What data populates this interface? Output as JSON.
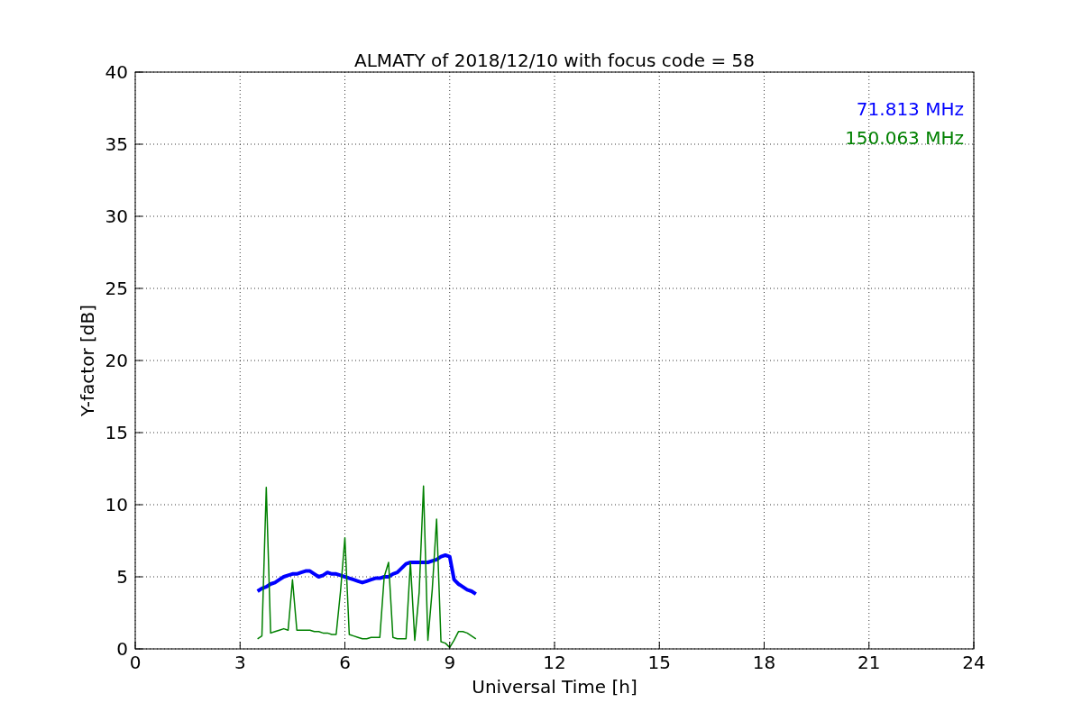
{
  "figure": {
    "chart_data": {
      "type": "line",
      "title": "ALMATY of 2018/12/10 with focus code = 58",
      "xlabel": "Universal Time [h]",
      "ylabel": "Y-factor [dB]",
      "x": [
        3.5,
        3.625,
        3.75,
        3.875,
        4.0,
        4.125,
        4.25,
        4.375,
        4.5,
        4.625,
        4.75,
        4.875,
        5.0,
        5.125,
        5.25,
        5.375,
        5.5,
        5.625,
        5.75,
        5.875,
        6.0,
        6.125,
        6.25,
        6.375,
        6.5,
        6.625,
        6.75,
        6.875,
        7.0,
        7.125,
        7.25,
        7.375,
        7.5,
        7.625,
        7.75,
        7.875,
        8.0,
        8.125,
        8.25,
        8.375,
        8.5,
        8.625,
        8.75,
        8.875,
        9.0,
        9.125,
        9.25,
        9.375,
        9.5,
        9.625,
        9.75
      ],
      "series": [
        {
          "name": "71.813 MHz",
          "color": "#0000ff",
          "values": [
            4.0,
            4.2,
            4.3,
            4.5,
            4.6,
            4.8,
            5.0,
            5.1,
            5.2,
            5.2,
            5.3,
            5.4,
            5.4,
            5.2,
            5.0,
            5.1,
            5.3,
            5.2,
            5.2,
            5.1,
            5.0,
            4.9,
            4.8,
            4.7,
            4.6,
            4.7,
            4.8,
            4.9,
            4.9,
            5.0,
            5.0,
            5.2,
            5.3,
            5.6,
            5.9,
            6.0,
            6.0,
            6.0,
            6.0,
            6.0,
            6.1,
            6.2,
            6.4,
            6.5,
            6.4,
            4.8,
            4.5,
            4.3,
            4.1,
            4.0,
            3.8
          ]
        },
        {
          "name": "150.063 MHz",
          "color": "#008000",
          "values": [
            0.7,
            0.9,
            11.2,
            1.1,
            1.2,
            1.3,
            1.4,
            1.3,
            4.8,
            1.3,
            1.3,
            1.3,
            1.3,
            1.2,
            1.2,
            1.1,
            1.1,
            1.0,
            1.0,
            4.0,
            7.7,
            1.0,
            0.9,
            0.8,
            0.7,
            0.7,
            0.8,
            0.8,
            0.8,
            5.0,
            6.0,
            0.8,
            0.7,
            0.7,
            0.7,
            6.0,
            0.6,
            3.9,
            11.3,
            0.6,
            4.1,
            9.0,
            0.5,
            0.4,
            0.1,
            0.6,
            1.2,
            1.2,
            1.1,
            0.9,
            0.7
          ]
        }
      ],
      "xlim": [
        0,
        24
      ],
      "ylim": [
        0,
        40
      ],
      "xticks": [
        0,
        3,
        6,
        9,
        12,
        15,
        18,
        21,
        24
      ],
      "yticks": [
        0,
        5,
        10,
        15,
        20,
        25,
        30,
        35,
        40
      ],
      "grid": true
    }
  }
}
